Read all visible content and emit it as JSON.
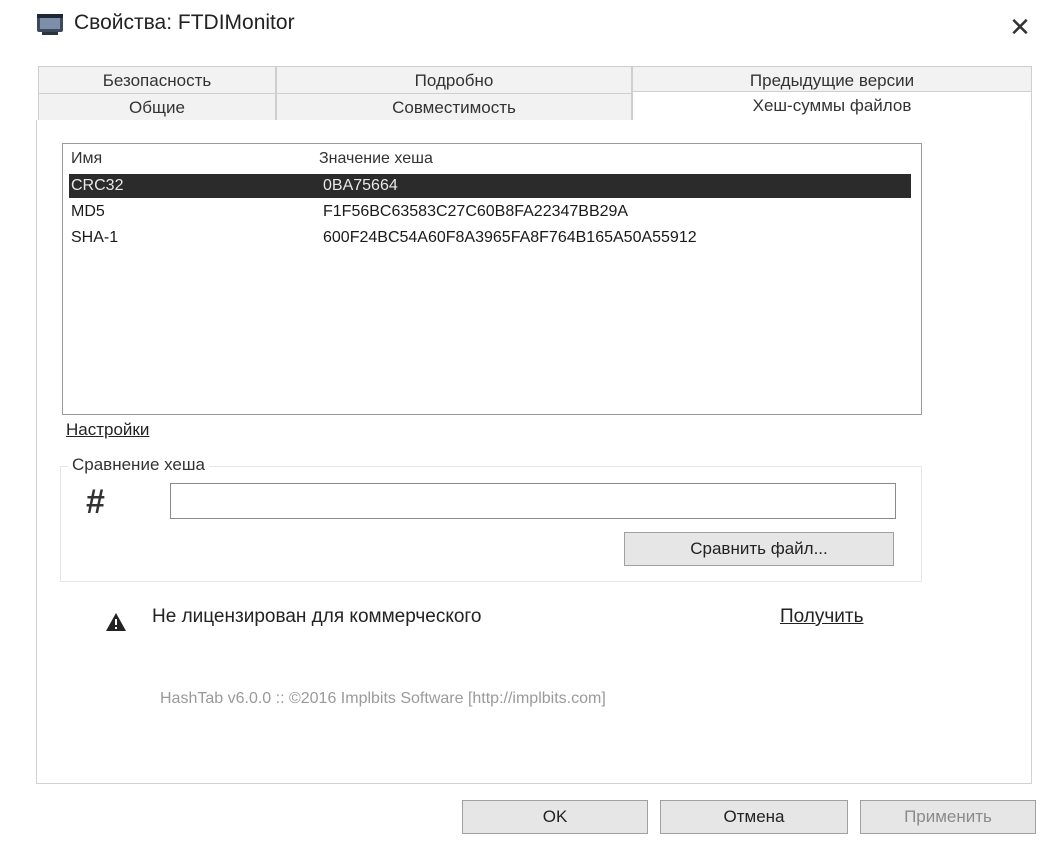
{
  "window": {
    "title": "Свойства: FTDIMonitor",
    "close_symbol": "✕",
    "icon": "app-window-icon"
  },
  "tabs_back": [
    {
      "label": "Безопасность"
    },
    {
      "label": "Подробно"
    },
    {
      "label": "Предыдущие версии"
    }
  ],
  "tabs_front": [
    {
      "label": "Общие"
    },
    {
      "label": "Совместимость"
    },
    {
      "label": "Хеш-суммы файлов",
      "active": true
    }
  ],
  "hash_list": {
    "columns": [
      "Имя",
      "Значение хеша"
    ],
    "rows": [
      {
        "name": "CRC32",
        "value": "0BA75664",
        "selected": true
      },
      {
        "name": "MD5",
        "value": "F1F56BC63583C27C60B8FA22347BB29A"
      },
      {
        "name": "SHA-1",
        "value": "600F24BC54A60F8A3965FA8F764B165A50A55912"
      }
    ]
  },
  "settings_link": "Настройки",
  "compare": {
    "group_label": "Сравнение хеша",
    "icon": "hash-icon",
    "input_value": "",
    "button_label": "Сравнить файл..."
  },
  "license": {
    "icon": "warning-icon",
    "text": "Не лицензирован для коммерческого",
    "link": "Получить"
  },
  "footer": "HashTab v6.0.0 :: ©2016 Implbits Software [http://implbits.com]",
  "buttons": {
    "ok": "OK",
    "cancel": "Отмена",
    "apply": "Применить"
  },
  "colors": {
    "selected_row_bg": "#2b2b2b",
    "footer_text": "#9a9a9a"
  }
}
